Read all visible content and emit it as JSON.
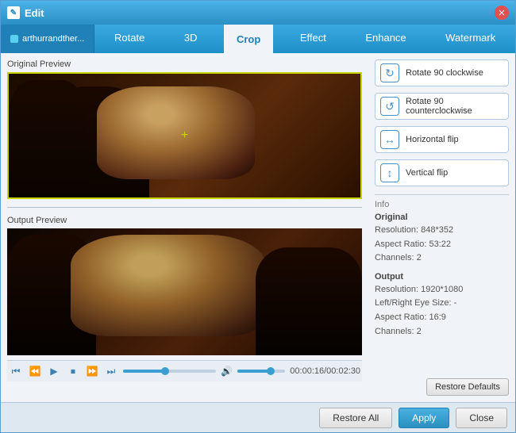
{
  "window": {
    "title": "Edit",
    "close_label": "✕"
  },
  "file_tab": {
    "label": "arthurrandther..."
  },
  "tabs": [
    {
      "id": "rotate",
      "label": "Rotate",
      "active": false
    },
    {
      "id": "3d",
      "label": "3D",
      "active": false
    },
    {
      "id": "crop",
      "label": "Crop",
      "active": true
    },
    {
      "id": "effect",
      "label": "Effect",
      "active": false
    },
    {
      "id": "enhance",
      "label": "Enhance",
      "active": false
    },
    {
      "id": "watermark",
      "label": "Watermark",
      "active": false
    }
  ],
  "previews": {
    "original_label": "Original Preview",
    "output_label": "Output Preview"
  },
  "rotate_buttons": [
    {
      "id": "rotate-cw",
      "label": "Rotate 90 clockwise",
      "icon": "↻"
    },
    {
      "id": "rotate-ccw",
      "label": "Rotate 90 counterclockwise",
      "icon": "↺"
    },
    {
      "id": "flip-h",
      "label": "Horizontal flip",
      "icon": "↔"
    },
    {
      "id": "flip-v",
      "label": "Vertical flip",
      "icon": "↕"
    }
  ],
  "info": {
    "section_label": "Info",
    "original_title": "Original",
    "original_resolution": "Resolution: 848*352",
    "original_aspect": "Aspect Ratio: 53:22",
    "original_channels": "Channels: 2",
    "output_title": "Output",
    "output_resolution": "Resolution: 1920*1080",
    "output_leftright": "Left/Right Eye Size: -",
    "output_aspect": "Aspect Ratio: 16:9",
    "output_channels": "Channels: 2"
  },
  "controls": {
    "time": "00:00:16/00:02:30",
    "restore_defaults": "Restore Defaults"
  },
  "bottom_buttons": {
    "restore_all": "Restore All",
    "apply": "Apply",
    "close": "Close"
  }
}
